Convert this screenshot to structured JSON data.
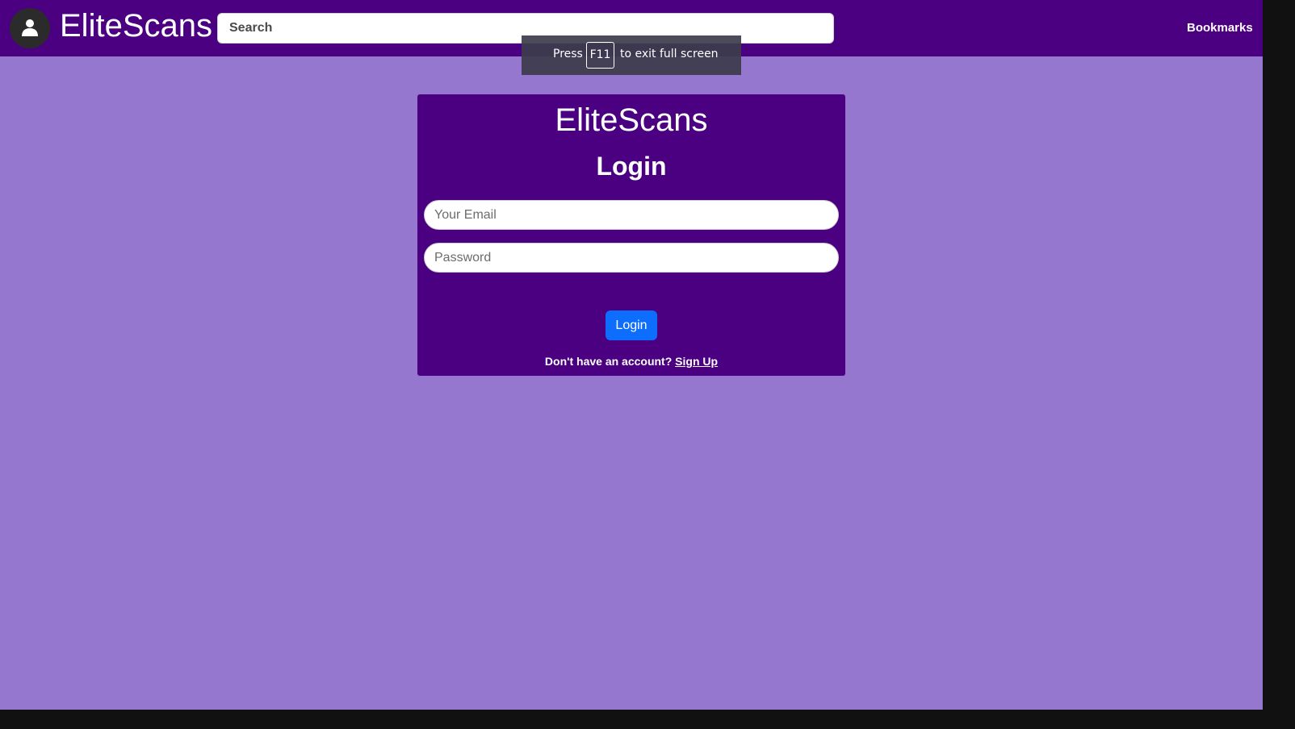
{
  "navbar": {
    "brand": "EliteScans",
    "search_placeholder": "Search",
    "bookmarks_label": "Bookmarks"
  },
  "fullscreen_notice": {
    "press": "Press",
    "key": "F11",
    "rest": "to exit full screen"
  },
  "login": {
    "brand": "EliteScans",
    "title": "Login",
    "email_placeholder": "Your Email",
    "password_placeholder": "Password",
    "submit_label": "Login",
    "signup_prompt": "Don't have an account?",
    "signup_link": "Sign Up"
  },
  "colors": {
    "page_background": "#9577cf",
    "navbar": "#4b0082",
    "card": "#4b0082",
    "button": "#0d6efd"
  },
  "icons": {
    "avatar": "user-icon"
  }
}
